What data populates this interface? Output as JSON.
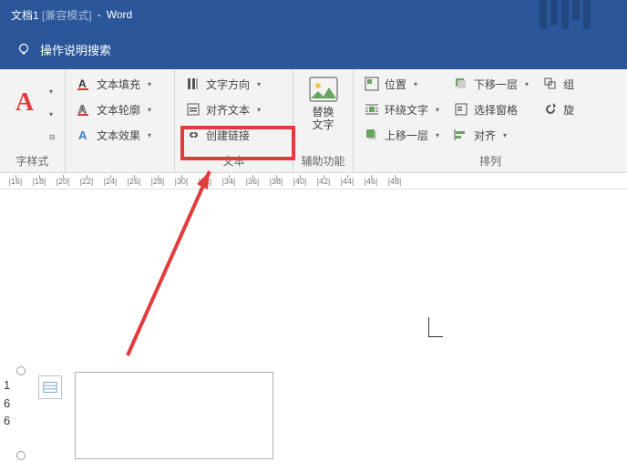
{
  "title": {
    "doc": "文档1",
    "mode": "[兼容模式]",
    "sep": " - ",
    "app": "Word"
  },
  "tellme": {
    "label": "操作说明搜索"
  },
  "group_labels": {
    "wordart": "字样式",
    "text": "文本",
    "access": "辅助功能",
    "arrange": "排列"
  },
  "cmds": {
    "text_fill": "文本填充",
    "text_outline": "文本轮廓",
    "text_effects": "文本效果",
    "text_direction": "文字方向",
    "align_text": "对齐文本",
    "create_link": "创建链接",
    "position": "位置",
    "wrap_text": "环绕文字",
    "bring_forward": "上移一层",
    "send_backward": "下移一层",
    "selection_pane": "选择窗格",
    "align": "对齐",
    "group": "组",
    "rotate": "旋"
  },
  "replace": {
    "line1": "替换",
    "line2": "文字"
  },
  "ruler_ticks": [
    "|16|",
    "|18|",
    "|20|",
    "|22|",
    "|24|",
    "|26|",
    "|28|",
    "|30|",
    "|32|",
    "|34|",
    "|36|",
    "|38|",
    "|40|",
    "|42|",
    "|44|",
    "|46|",
    "|48|"
  ],
  "line_numbers": [
    "1",
    "6",
    "6"
  ],
  "colors": {
    "accent": "#2b579a",
    "highlight": "#e23b3b"
  }
}
